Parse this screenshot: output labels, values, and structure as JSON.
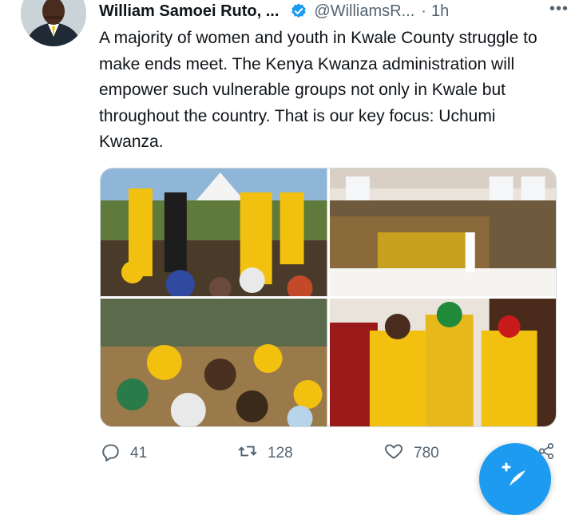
{
  "tweet": {
    "author_name": "William Samoei Ruto, ...",
    "handle": "@WilliamsR...",
    "separator": "·",
    "time": "1h",
    "more_label": "•••",
    "text": "A majority of women and youth in Kwale County struggle to make ends meet. The Kenya Kwanza administration will empower such vulnerable groups not only in Kwale but throughout the country. That is our key focus: Uchumi Kwanza."
  },
  "stats": {
    "replies": "41",
    "retweets": "128",
    "likes": "780"
  },
  "colors": {
    "accent": "#1d9bf0",
    "text": "#0f1419",
    "secondary": "#536471",
    "party_yellow": "#f2c10f"
  },
  "icons": [
    "verified-icon",
    "more-icon",
    "reply-icon",
    "retweet-icon",
    "like-icon",
    "share-icon",
    "compose-icon"
  ]
}
